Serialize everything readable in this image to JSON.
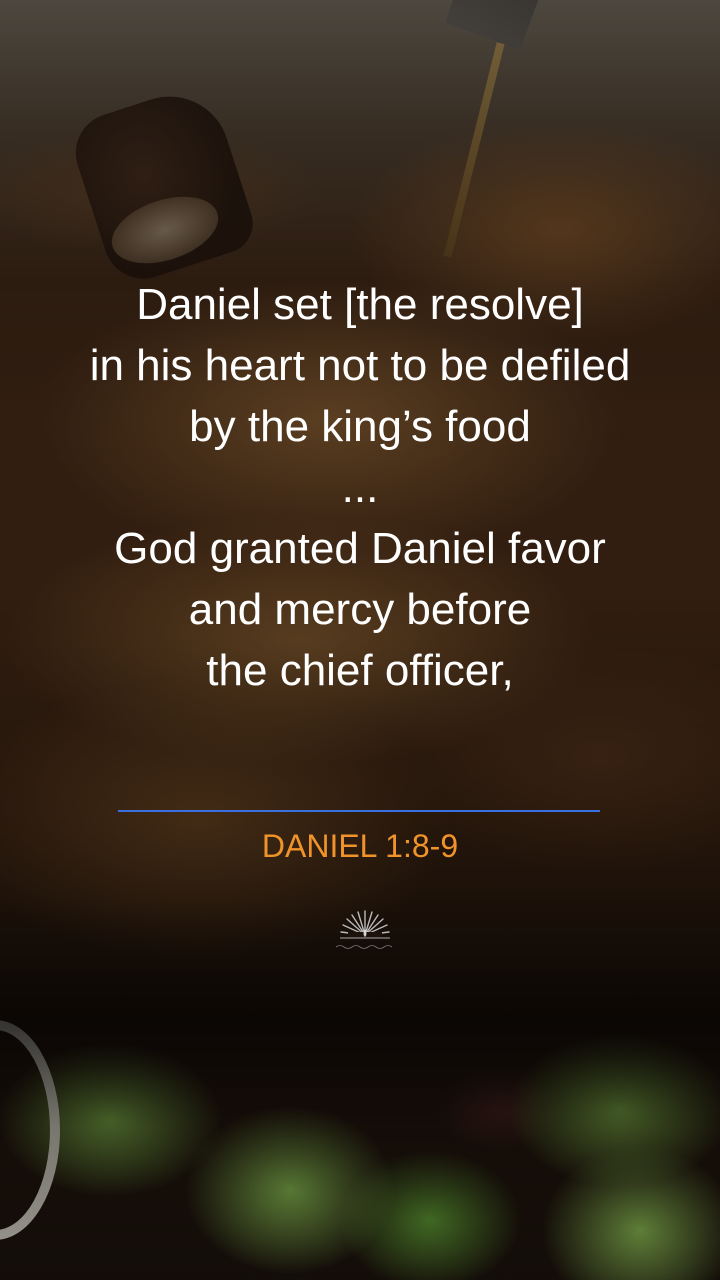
{
  "verse": {
    "lines": [
      "Daniel set [the resolve]",
      "in his heart not to be defiled",
      "by the king’s food",
      "...",
      "God granted Daniel favor",
      "and mercy before",
      "the chief officer,"
    ]
  },
  "reference": "DANIEL 1:8-9",
  "colors": {
    "reference_text": "#f0932b",
    "divider": "#3a6fe0",
    "verse_text": "#ffffff"
  },
  "logo": {
    "icon": "sunburst-candle-logo-icon"
  }
}
